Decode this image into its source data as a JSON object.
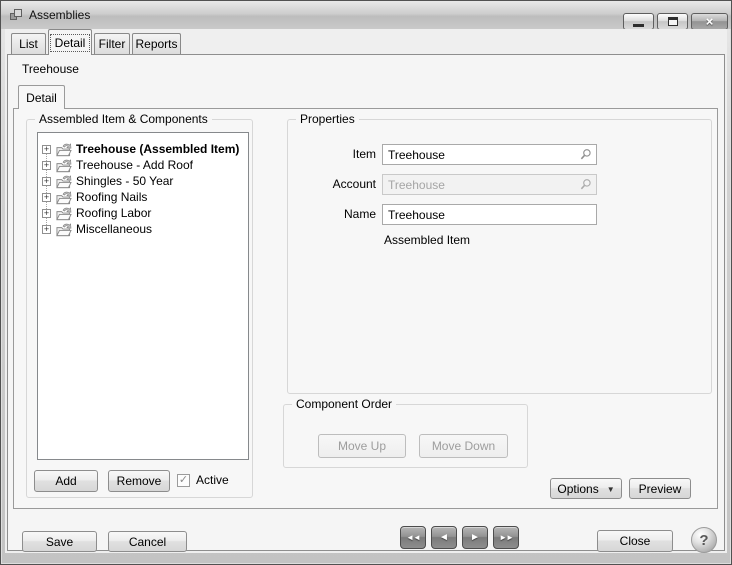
{
  "window": {
    "title": "Assemblies"
  },
  "glyphs": {
    "close_window": "×",
    "expander": "+",
    "dropdown_arrow": "▼",
    "nav_first": "◄◄",
    "nav_prev": "◄",
    "nav_next": "►",
    "nav_last": "►►",
    "help": "?",
    "check": "✓"
  },
  "tabs": {
    "items": [
      "List",
      "Detail",
      "Filter",
      "Reports"
    ],
    "selected": "Detail"
  },
  "record_title": "Treehouse",
  "inner_tab": {
    "label": "Detail"
  },
  "assembly_group": {
    "title": "Assembled Item & Components",
    "items": [
      "Treehouse (Assembled Item)",
      "Treehouse - Add Roof",
      "Shingles - 50 Year",
      "Roofing Nails",
      "Roofing Labor",
      "Miscellaneous"
    ],
    "add": "Add",
    "remove": "Remove",
    "active": {
      "label": "Active",
      "checked": true
    }
  },
  "properties": {
    "title": "Properties",
    "item": {
      "label": "Item",
      "value": "Treehouse"
    },
    "account": {
      "label": "Account",
      "value": "Treehouse",
      "disabled": true
    },
    "name": {
      "label": "Name",
      "value": "Treehouse"
    },
    "type_text": "Assembled Item"
  },
  "component_order": {
    "title": "Component Order",
    "move_up": "Move Up",
    "move_down": "Move Down"
  },
  "buttons": {
    "options": "Options",
    "preview": "Preview",
    "save": "Save",
    "cancel": "Cancel",
    "close": "Close"
  },
  "colors": {
    "panel_bg": "#f5f5f5",
    "titlebar_mid": "#c9c9c9",
    "disabled_text": "#9d9d9d",
    "nav_button": "#8e8e8e",
    "border_dark": "#8e8e8e",
    "groupbox_border": "#d7d7d7"
  }
}
